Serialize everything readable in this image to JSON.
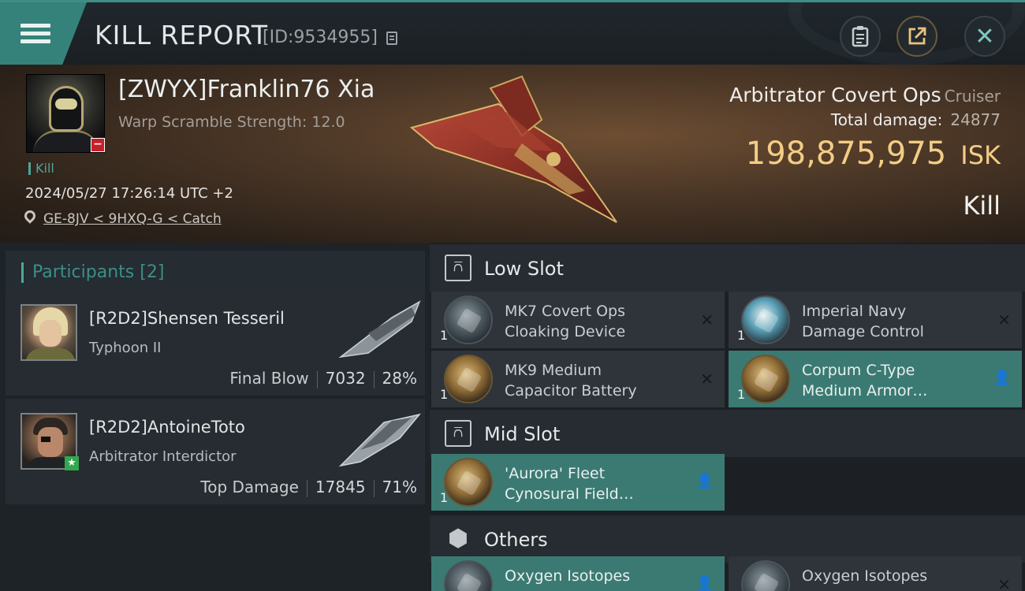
{
  "header": {
    "title": "KILL REPORT",
    "report_id": "[ID:9534955]",
    "close_symbol": "✕",
    "clipboard_symbol": "📋",
    "share_symbol": "⇱"
  },
  "victim": {
    "name": "[ZWYX]Franklin76 Xia",
    "warp_scramble": "Warp Scramble Strength: 12.0",
    "kill_tag": "Kill",
    "timestamp": "2024/05/27 17:26:14 UTC +2",
    "location": "GE-8JV < 9HXQ-G < Catch",
    "status_badge_symbol": "−"
  },
  "ship": {
    "name": "Arbitrator Covert Ops",
    "class": "Cruiser",
    "total_damage_label": "Total damage:",
    "total_damage_value": "24877",
    "isk_value": "198,875,975",
    "isk_unit": "ISK",
    "result": "Kill"
  },
  "participants": {
    "label": "Participants",
    "count": "[2]",
    "list": [
      {
        "name": "[R2D2]Shensen Tesseril",
        "ship": "Typhoon II",
        "role": "Final Blow",
        "damage": "7032",
        "percent": "28%"
      },
      {
        "name": "[R2D2]AntoineToto",
        "ship": "Arbitrator Interdictor",
        "role": "Top Damage",
        "damage": "17845",
        "percent": "71%",
        "badge_symbol": "★"
      }
    ]
  },
  "fittings": {
    "low_slot": {
      "title": "Low Slot",
      "icon_symbol": "⩃",
      "modules": [
        {
          "line1": "MK7 Covert Ops",
          "line2": "Cloaking Device",
          "qty": "1",
          "status": "destroyed",
          "status_symbol": "✕"
        },
        {
          "line1": "Imperial Navy",
          "line2": "Damage Control",
          "qty": "1",
          "status": "destroyed",
          "status_symbol": "✕"
        },
        {
          "line1": "MK9 Medium",
          "line2": "Capacitor Battery",
          "qty": "1",
          "status": "destroyed",
          "status_symbol": "✕"
        },
        {
          "line1": "Corpum C-Type",
          "line2": "Medium Armor…",
          "qty": "1",
          "status": "dropped",
          "status_symbol": "👤"
        }
      ]
    },
    "mid_slot": {
      "title": "Mid Slot",
      "icon_symbol": "⩃",
      "modules": [
        {
          "line1": "'Aurora' Fleet",
          "line2": "Cynosural Field…",
          "qty": "1",
          "status": "dropped",
          "status_symbol": "👤"
        }
      ]
    },
    "others": {
      "title": "Others",
      "icon_symbol": "⬢",
      "modules": [
        {
          "line1": "Oxygen Isotopes",
          "line2": "",
          "qty": "",
          "status": "dropped",
          "status_symbol": "👤"
        },
        {
          "line1": "Oxygen Isotopes",
          "line2": "",
          "qty": "",
          "status": "destroyed",
          "status_symbol": "✕"
        }
      ]
    }
  },
  "colors": {
    "accent_teal": "#3b7a72",
    "isk_gold": "#f2cd85",
    "banner_brown": "#4a3626",
    "danger_red": "#c8202a"
  }
}
